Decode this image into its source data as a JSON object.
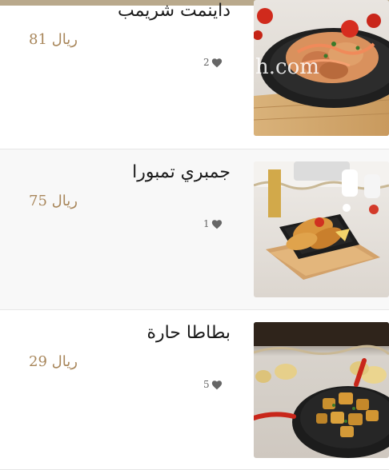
{
  "menu": {
    "items": [
      {
        "name": "داينمت شريمب",
        "price": "81 ريال",
        "likes": "2",
        "watermark": "h.com"
      },
      {
        "name": "جمبري تمبورا",
        "price": "75 ريال",
        "likes": "1"
      },
      {
        "name": "بطاطا حارة",
        "price": "29 ريال",
        "likes": "5"
      }
    ]
  },
  "colors": {
    "top_bar": "#b9a98c",
    "price": "#a8865a",
    "heart": "#666666"
  }
}
